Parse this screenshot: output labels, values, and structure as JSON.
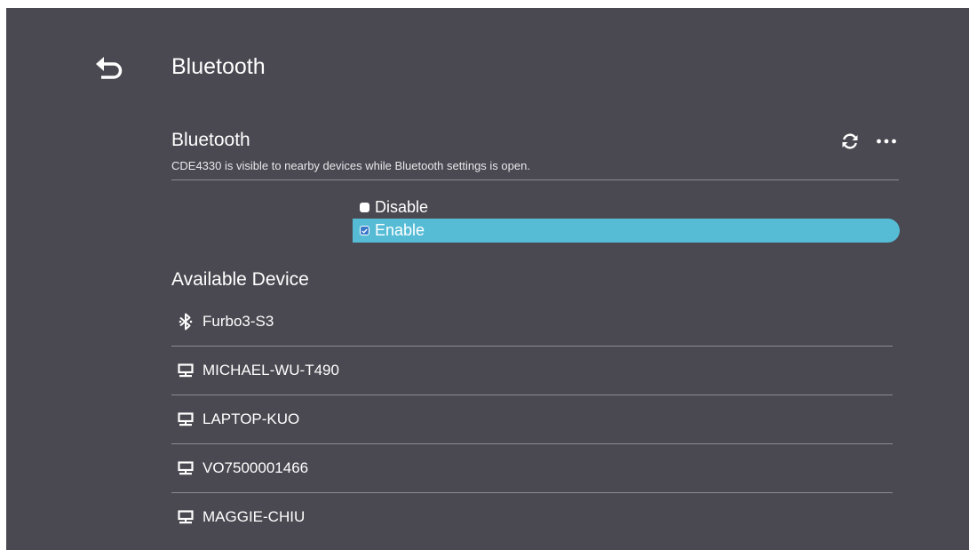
{
  "header": {
    "title": "Bluetooth",
    "back_icon": "back-arrow-icon"
  },
  "bluetooth_section": {
    "title": "Bluetooth",
    "description": "CDE4330 is visible to nearby devices while Bluetooth settings is open.",
    "refresh_icon": "refresh-icon",
    "more_icon": "more-horizontal-icon"
  },
  "options": {
    "disable_label": "Disable",
    "enable_label": "Enable",
    "selected": "Enable",
    "highlight_color": "#56bcd6"
  },
  "available": {
    "title": "Available Device",
    "devices": [
      {
        "name": "Furbo3-S3",
        "icon": "bluetooth-icon"
      },
      {
        "name": "MICHAEL-WU-T490",
        "icon": "computer-icon"
      },
      {
        "name": "LAPTOP-KUO",
        "icon": "computer-icon"
      },
      {
        "name": "VO7500001466",
        "icon": "computer-icon"
      },
      {
        "name": "MAGGIE-CHIU",
        "icon": "computer-icon"
      }
    ]
  },
  "colors": {
    "background": "#4a4850",
    "text": "#ffffff",
    "divider": "#8c8a92"
  }
}
